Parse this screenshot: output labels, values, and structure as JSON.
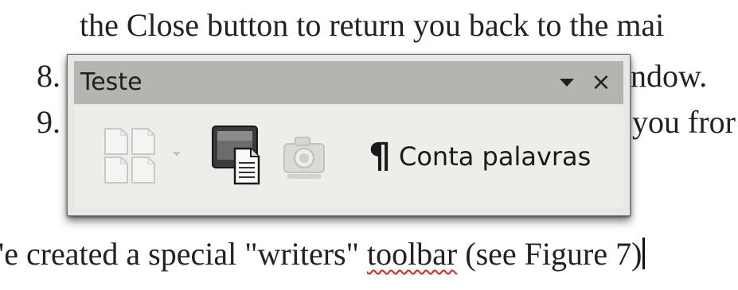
{
  "document": {
    "line_top": "the Close button to return you back to the mai",
    "num_8": "8.",
    "line_8_tail": "ndow.",
    "num_9": "9.",
    "line_9_tail": "you fror",
    "line_bottom_a": "'e created a special \"writers\" ",
    "line_bottom_misspelled": "toolbar",
    "line_bottom_b": " (see Figure 7)"
  },
  "toolbar_window": {
    "title": "Teste",
    "menu_icon": "triangle-down",
    "close_symbol": "×",
    "tools": {
      "pages_icon": "pages-icon",
      "dropdown_icon": "triangle-down",
      "screen_icon": "screen-document-icon",
      "camera_icon": "camera-icon",
      "wordcount_symbol": "¶",
      "wordcount_label": "Conta palavras"
    }
  },
  "colors": {
    "titlebar": "#b4b4b1",
    "toolbar_bg": "#ededea",
    "spell_squiggle": "#e02020"
  }
}
